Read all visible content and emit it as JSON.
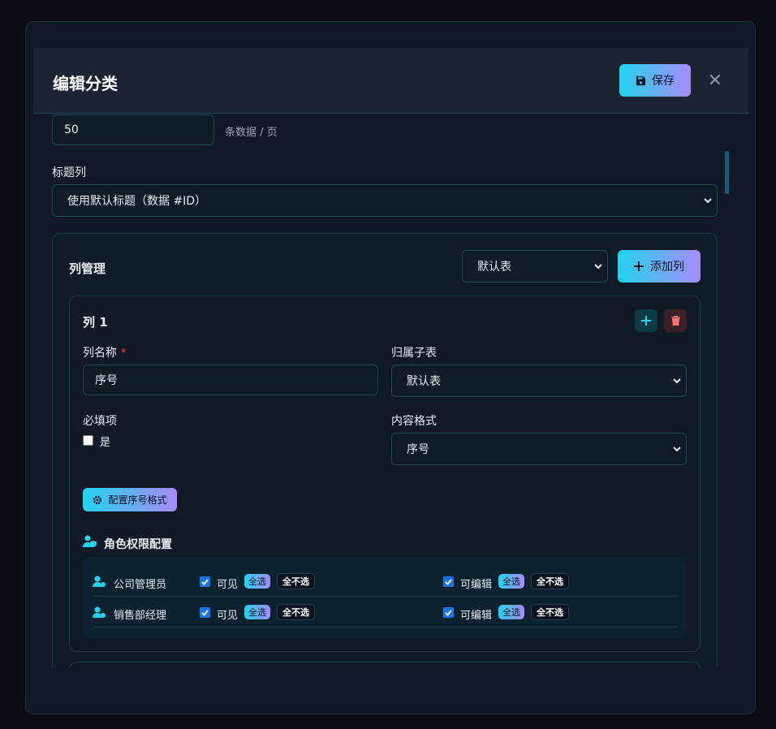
{
  "modal": {
    "title": "编辑分类",
    "save_label": "保存"
  },
  "pagination": {
    "value": "50",
    "suffix": "条数据 / 页"
  },
  "title_column": {
    "label": "标题列",
    "selected": "使用默认标题（数据 #ID）"
  },
  "column_management": {
    "title": "列管理",
    "table_select": "默认表",
    "add_column_label": "添加列"
  },
  "column_card": {
    "title": "列 1",
    "name_label": "列名称",
    "required_mark": "*",
    "name_value": "序号",
    "subtable_label": "归属子表",
    "subtable_value": "默认表",
    "required_label": "必填项",
    "required_option": "是",
    "format_label": "内容格式",
    "format_value": "序号",
    "config_button": "配置序号格式",
    "permissions_title": "角色权限配置"
  },
  "permissions": [
    {
      "role": "公司管理员",
      "visible_label": "可见",
      "visible_checked": true,
      "editable_label": "可编辑",
      "editable_checked": true,
      "select_all": "全选",
      "select_none": "全不选"
    },
    {
      "role": "销售部经理",
      "visible_label": "可见",
      "visible_checked": true,
      "editable_label": "可编辑",
      "editable_checked": true,
      "select_all": "全选",
      "select_none": "全不选"
    }
  ],
  "colors": {
    "accent_start": "#22d3ee",
    "accent_end": "#a78bfa",
    "danger": "#f87171",
    "checkbox": "#1a73e8"
  }
}
